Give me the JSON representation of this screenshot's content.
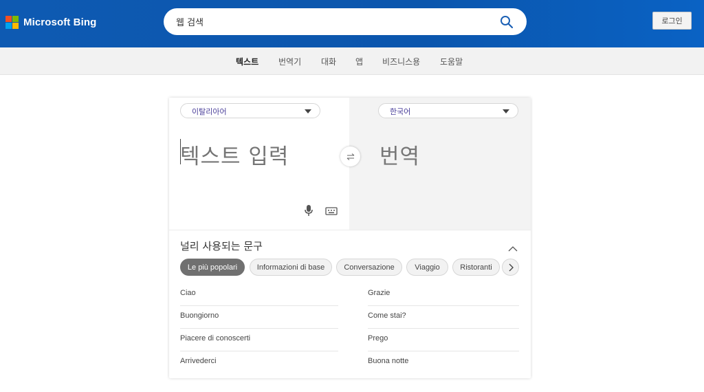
{
  "header": {
    "brand": "Microsoft Bing",
    "logo_colors": [
      "#f25022",
      "#7fba00",
      "#00a4ef",
      "#ffb900"
    ],
    "search_value": "웹 검색",
    "login_label": "로그인"
  },
  "nav": {
    "items": [
      {
        "label": "텍스트",
        "active": true
      },
      {
        "label": "번역기",
        "active": false
      },
      {
        "label": "대화",
        "active": false
      },
      {
        "label": "앱",
        "active": false
      },
      {
        "label": "비즈니스용",
        "active": false
      },
      {
        "label": "도움말",
        "active": false
      }
    ]
  },
  "translator": {
    "source_lang": "이탈리아어",
    "target_lang": "한국어",
    "input_placeholder": "텍스트 입력",
    "output_placeholder": "번역"
  },
  "phrases": {
    "title": "널리 사용되는 문구",
    "categories": [
      {
        "label": "Le più popolari",
        "active": true
      },
      {
        "label": "Informazioni di base",
        "active": false
      },
      {
        "label": "Conversazione",
        "active": false
      },
      {
        "label": "Viaggio",
        "active": false
      },
      {
        "label": "Ristoranti",
        "active": false
      }
    ],
    "left": [
      "Ciao",
      "Buongiorno",
      "Piacere di conoscerti",
      "Arrivederci"
    ],
    "right": [
      "Grazie",
      "Come stai?",
      "Prego",
      "Buona notte"
    ]
  },
  "colors": {
    "header_blue": "#0e5ab2",
    "active_chip": "#707070",
    "language_text": "#4a3f9a"
  }
}
